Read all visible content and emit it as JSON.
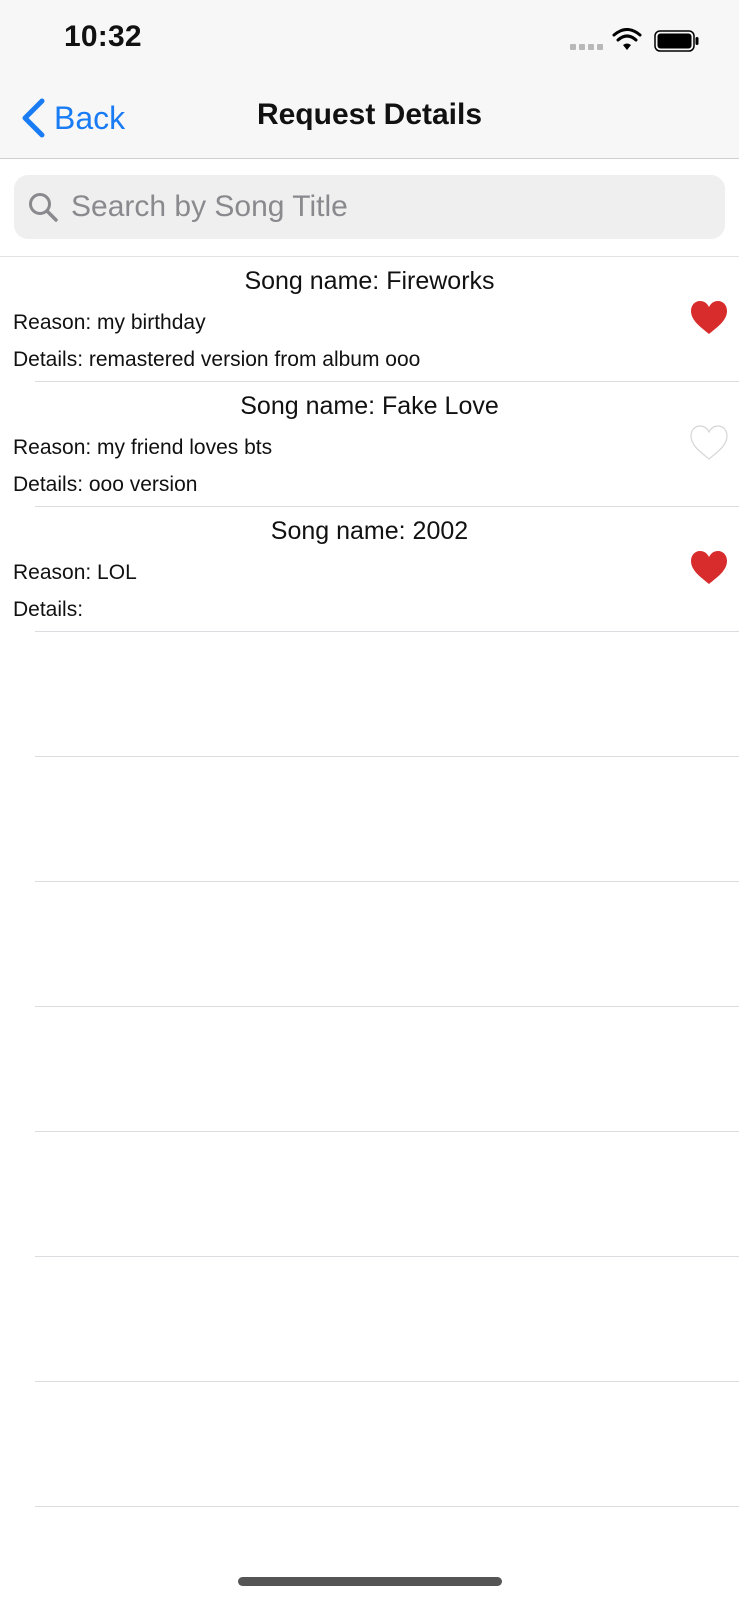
{
  "status_bar": {
    "time": "10:32"
  },
  "nav": {
    "back_label": "Back",
    "title": "Request Details"
  },
  "search": {
    "placeholder": "Search by Song Title"
  },
  "requests": [
    {
      "song": "Song name: Fireworks",
      "reason": "Reason: my birthday",
      "details": "Details: remastered version from album ooo",
      "liked": true
    },
    {
      "song": "Song name: Fake Love",
      "reason": "Reason: my friend loves bts",
      "details": "Details: ooo version",
      "liked": false
    },
    {
      "song": "Song name: 2002",
      "reason": "Reason: LOL",
      "details": "Details:",
      "liked": true
    }
  ],
  "colors": {
    "accent": "#1a7cf5",
    "heart_filled": "#d82c2c",
    "heart_empty": "#d6d6d6"
  },
  "icons": {
    "back": "chevron-left-icon",
    "search": "magnifier-icon",
    "like": "heart-icon"
  }
}
